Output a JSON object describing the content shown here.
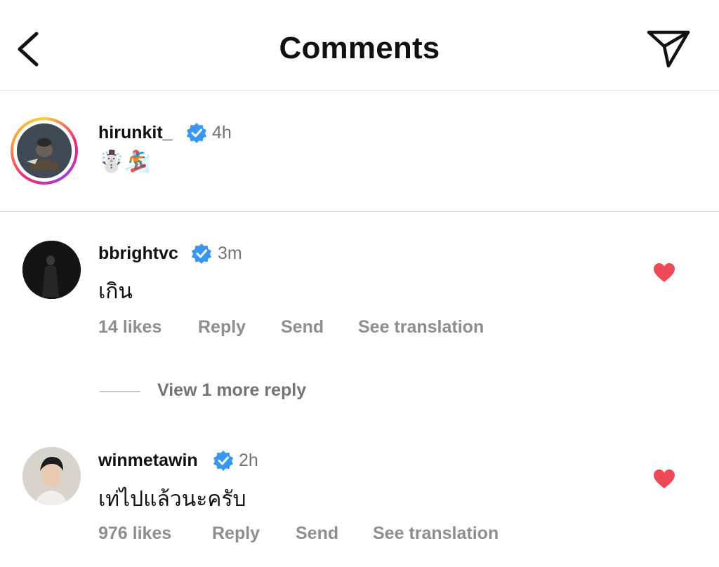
{
  "header": {
    "title": "Comments",
    "back_icon": "chevron-left-icon",
    "send_icon": "paper-plane-icon"
  },
  "caption": {
    "username": "hirunkit_",
    "verified": true,
    "time": "4h",
    "text": "☃️🏂"
  },
  "comments": [
    {
      "username": "bbrightvc",
      "verified": true,
      "time": "3m",
      "text": "เกิน",
      "likes": "14 likes",
      "reply_label": "Reply",
      "send_label": "Send",
      "translate_label": "See translation",
      "liked": true
    },
    {
      "username": "winmetawin",
      "verified": true,
      "time": "2h",
      "text": "เท่ไปแล้วนะครับ",
      "likes": "976 likes",
      "reply_label": "Reply",
      "send_label": "Send",
      "translate_label": "See translation",
      "liked": true
    }
  ],
  "more_replies": "View 1 more reply",
  "colors": {
    "verified": "#3897f0",
    "heart": "#ed4956",
    "muted": "#8e8e8e",
    "divider": "#dbdbdb"
  }
}
